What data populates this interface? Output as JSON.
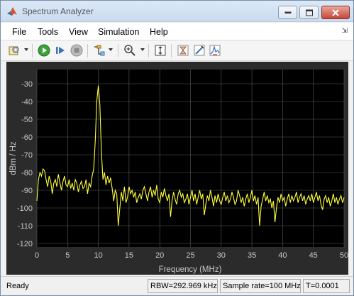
{
  "window": {
    "title": "Spectrum Analyzer"
  },
  "menu": {
    "items": [
      "File",
      "Tools",
      "View",
      "Simulation",
      "Help"
    ]
  },
  "toolbar": {
    "icons": [
      "settings-icon",
      "run-icon",
      "step-forward-icon",
      "stop-icon",
      "signal-select-icon",
      "zoom-in-icon",
      "scale-axes-icon",
      "trigger-icon",
      "measurements-icon",
      "peak-finder-icon"
    ]
  },
  "chart_data": {
    "type": "line",
    "xlabel": "Frequency (MHz)",
    "ylabel": "dBm / Hz",
    "xlim": [
      0,
      50
    ],
    "ylim": [
      -122,
      -22
    ],
    "xticks": [
      "0",
      "5",
      "10",
      "15",
      "20",
      "25",
      "30",
      "35",
      "40",
      "45",
      "50"
    ],
    "yticks": [
      "-30",
      "-40",
      "-50",
      "-60",
      "-70",
      "-80",
      "-90",
      "-100",
      "-110",
      "-120"
    ],
    "grid": true,
    "colors": {
      "background": "#000000",
      "panel": "#2b2b2b",
      "grid": "#5a5a5a",
      "trace": "#ffff3a",
      "text": "#c8c8c8"
    },
    "series": [
      {
        "values": [
          [
            0.0,
            -96
          ],
          [
            0.25,
            -84
          ],
          [
            0.5,
            -80
          ],
          [
            0.75,
            -82
          ],
          [
            1.0,
            -78
          ],
          [
            1.25,
            -79
          ],
          [
            1.5,
            -84
          ],
          [
            1.75,
            -88
          ],
          [
            2.0,
            -82
          ],
          [
            2.25,
            -85
          ],
          [
            2.5,
            -92
          ],
          [
            2.75,
            -86
          ],
          [
            3.0,
            -84
          ],
          [
            3.25,
            -88
          ],
          [
            3.5,
            -81
          ],
          [
            3.75,
            -86
          ],
          [
            4.0,
            -90
          ],
          [
            4.25,
            -85
          ],
          [
            4.5,
            -82
          ],
          [
            4.75,
            -87
          ],
          [
            5.0,
            -88
          ],
          [
            5.25,
            -84
          ],
          [
            5.5,
            -89
          ],
          [
            5.75,
            -86
          ],
          [
            6.0,
            -90
          ],
          [
            6.25,
            -84
          ],
          [
            6.5,
            -86
          ],
          [
            6.75,
            -91
          ],
          [
            7.0,
            -87
          ],
          [
            7.25,
            -85
          ],
          [
            7.5,
            -89
          ],
          [
            7.75,
            -88
          ],
          [
            8.0,
            -84
          ],
          [
            8.25,
            -92
          ],
          [
            8.5,
            -86
          ],
          [
            8.75,
            -88
          ],
          [
            9.0,
            -82
          ],
          [
            9.25,
            -78
          ],
          [
            9.5,
            -62
          ],
          [
            9.75,
            -40
          ],
          [
            10.0,
            -31
          ],
          [
            10.25,
            -42
          ],
          [
            10.5,
            -68
          ],
          [
            10.75,
            -84
          ],
          [
            11.0,
            -80
          ],
          [
            11.25,
            -87
          ],
          [
            11.5,
            -82
          ],
          [
            11.75,
            -86
          ],
          [
            12.0,
            -83
          ],
          [
            12.25,
            -89
          ],
          [
            12.5,
            -96
          ],
          [
            12.75,
            -90
          ],
          [
            13.0,
            -92
          ],
          [
            13.25,
            -110
          ],
          [
            13.5,
            -100
          ],
          [
            13.75,
            -91
          ],
          [
            14.0,
            -96
          ],
          [
            14.25,
            -88
          ],
          [
            14.5,
            -97
          ],
          [
            14.75,
            -94
          ],
          [
            15.0,
            -88
          ],
          [
            15.25,
            -92
          ],
          [
            15.5,
            -90
          ],
          [
            15.75,
            -94
          ],
          [
            16.0,
            -91
          ],
          [
            16.25,
            -97
          ],
          [
            16.5,
            -94
          ],
          [
            16.75,
            -92
          ],
          [
            17.0,
            -95
          ],
          [
            17.25,
            -90
          ],
          [
            17.5,
            -88
          ],
          [
            17.75,
            -92
          ],
          [
            18.0,
            -96
          ],
          [
            18.25,
            -91
          ],
          [
            18.5,
            -88
          ],
          [
            18.75,
            -94
          ],
          [
            19.0,
            -90
          ],
          [
            19.25,
            -93
          ],
          [
            19.5,
            -87
          ],
          [
            19.75,
            -95
          ],
          [
            20.0,
            -97
          ],
          [
            20.25,
            -91
          ],
          [
            20.5,
            -94
          ],
          [
            20.75,
            -89
          ],
          [
            21.0,
            -93
          ],
          [
            21.25,
            -96
          ],
          [
            21.5,
            -92
          ],
          [
            21.75,
            -105
          ],
          [
            22.0,
            -96
          ],
          [
            22.25,
            -91
          ],
          [
            22.5,
            -95
          ],
          [
            22.75,
            -98
          ],
          [
            23.0,
            -92
          ],
          [
            23.25,
            -90
          ],
          [
            23.5,
            -94
          ],
          [
            23.75,
            -92
          ],
          [
            24.0,
            -97
          ],
          [
            24.25,
            -95
          ],
          [
            24.5,
            -92
          ],
          [
            24.75,
            -98
          ],
          [
            25.0,
            -94
          ],
          [
            25.25,
            -90
          ],
          [
            25.5,
            -96
          ],
          [
            25.75,
            -92
          ],
          [
            26.0,
            -98
          ],
          [
            26.25,
            -94
          ],
          [
            26.5,
            -90
          ],
          [
            26.75,
            -95
          ],
          [
            27.0,
            -92
          ],
          [
            27.25,
            -104
          ],
          [
            27.5,
            -98
          ],
          [
            27.75,
            -93
          ],
          [
            28.0,
            -96
          ],
          [
            28.25,
            -90
          ],
          [
            28.5,
            -94
          ],
          [
            28.75,
            -99
          ],
          [
            29.0,
            -93
          ],
          [
            29.25,
            -97
          ],
          [
            29.5,
            -92
          ],
          [
            29.75,
            -96
          ],
          [
            30.0,
            -98
          ],
          [
            30.25,
            -94
          ],
          [
            30.5,
            -91
          ],
          [
            30.75,
            -96
          ],
          [
            31.0,
            -93
          ],
          [
            31.25,
            -97
          ],
          [
            31.5,
            -95
          ],
          [
            31.75,
            -91
          ],
          [
            32.0,
            -94
          ],
          [
            32.25,
            -98
          ],
          [
            32.5,
            -96
          ],
          [
            32.75,
            -90
          ],
          [
            33.0,
            -93
          ],
          [
            33.25,
            -97
          ],
          [
            33.5,
            -94
          ],
          [
            33.75,
            -99
          ],
          [
            34.0,
            -95
          ],
          [
            34.25,
            -92
          ],
          [
            34.5,
            -97
          ],
          [
            34.75,
            -94
          ],
          [
            35.0,
            -90
          ],
          [
            35.25,
            -96
          ],
          [
            35.5,
            -93
          ],
          [
            35.75,
            -98
          ],
          [
            36.0,
            -94
          ],
          [
            36.25,
            -110
          ],
          [
            36.5,
            -99
          ],
          [
            36.75,
            -95
          ],
          [
            37.0,
            -91
          ],
          [
            37.25,
            -96
          ],
          [
            37.5,
            -93
          ],
          [
            37.75,
            -97
          ],
          [
            38.0,
            -95
          ],
          [
            38.25,
            -100
          ],
          [
            38.5,
            -96
          ],
          [
            38.75,
            -108
          ],
          [
            39.0,
            -100
          ],
          [
            39.25,
            -94
          ],
          [
            39.5,
            -97
          ],
          [
            39.75,
            -92
          ],
          [
            40.0,
            -96
          ],
          [
            40.25,
            -94
          ],
          [
            40.5,
            -99
          ],
          [
            40.75,
            -95
          ],
          [
            41.0,
            -92
          ],
          [
            41.25,
            -97
          ],
          [
            41.5,
            -93
          ],
          [
            41.75,
            -96
          ],
          [
            42.0,
            -94
          ],
          [
            42.25,
            -91
          ],
          [
            42.5,
            -97
          ],
          [
            42.75,
            -94
          ],
          [
            43.0,
            -92
          ],
          [
            43.25,
            -96
          ],
          [
            43.5,
            -93
          ],
          [
            43.75,
            -98
          ],
          [
            44.0,
            -95
          ],
          [
            44.25,
            -93
          ],
          [
            44.5,
            -96
          ],
          [
            44.75,
            -92
          ],
          [
            45.0,
            -97
          ],
          [
            45.25,
            -94
          ],
          [
            45.5,
            -91
          ],
          [
            45.75,
            -96
          ],
          [
            46.0,
            -93
          ],
          [
            46.25,
            -98
          ],
          [
            46.5,
            -101
          ],
          [
            46.75,
            -95
          ],
          [
            47.0,
            -93
          ],
          [
            47.25,
            -97
          ],
          [
            47.5,
            -94
          ],
          [
            47.75,
            -99
          ],
          [
            48.0,
            -96
          ],
          [
            48.25,
            -92
          ],
          [
            48.5,
            -97
          ],
          [
            48.75,
            -94
          ],
          [
            49.0,
            -98
          ],
          [
            49.25,
            -95
          ],
          [
            49.5,
            -93
          ],
          [
            49.75,
            -97
          ],
          [
            50.0,
            -94
          ]
        ]
      }
    ]
  },
  "status": {
    "ready": "Ready",
    "rbw": "RBW=292.969 kHz",
    "sample_rate": "Sample rate=100 MHz",
    "time": "T=0.0001"
  }
}
